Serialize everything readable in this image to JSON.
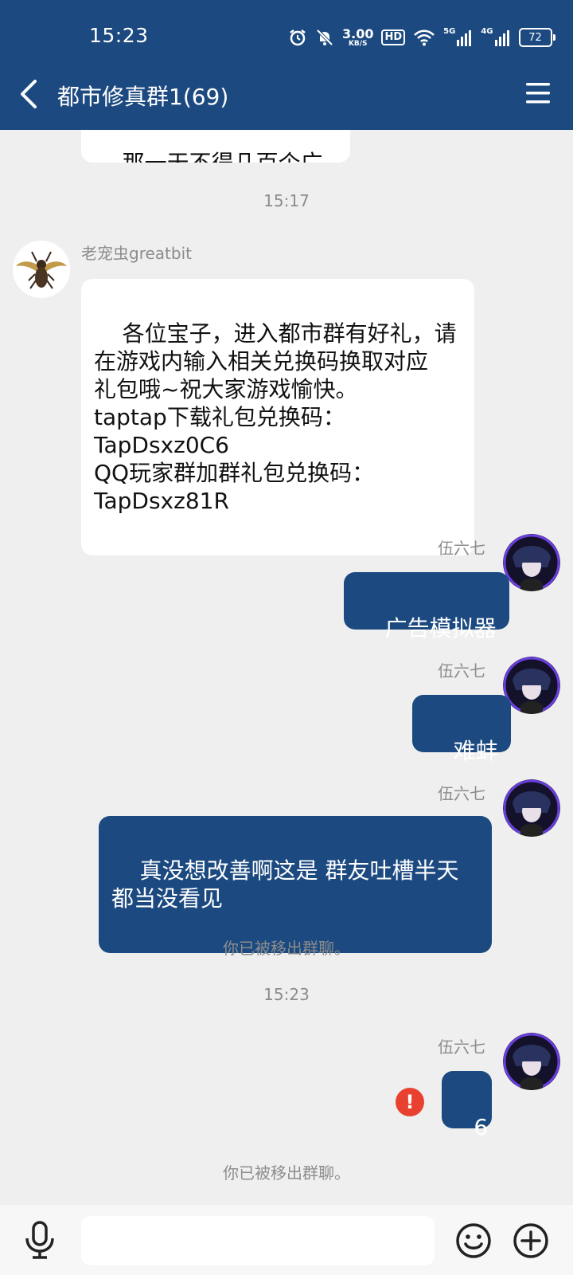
{
  "status_bar": {
    "time": "15:23",
    "net_speed": "3.00",
    "net_speed_unit": "KB/S",
    "hd_label": "HD",
    "net1_label": "5G",
    "net2_label": "4G",
    "battery": "72"
  },
  "header": {
    "title": "都市修真群1(69)"
  },
  "messages": {
    "m0": {
      "text": "那一天不得几百个广告"
    },
    "ts1": "15:17",
    "m1": {
      "sender": "老宠虫greatbit",
      "text": "各位宝子，进入都市群有好礼，请\n在游戏内输入相关兑换码换取对应\n礼包哦~祝大家游戏愉快。\ntaptap下载礼包兑换码：\nTapDsxz0C6\nQQ玩家群加群礼包兑换码：\nTapDsxz81R"
    },
    "m2": {
      "sender": "伍六七",
      "text": "广告模拟器"
    },
    "m3": {
      "sender": "伍六七",
      "text": "难蚌"
    },
    "m4": {
      "sender": "伍六七",
      "text": "真没想改善啊这是 群友吐槽半天\n都当没看见"
    },
    "sys1": "你已被移出群聊。",
    "ts2": "15:23",
    "m5": {
      "sender": "伍六七",
      "text": "6"
    },
    "sys2": "你已被移出群聊。"
  },
  "input": {
    "placeholder": ""
  },
  "colors": {
    "brand": "#1c4a80",
    "background": "#efefef",
    "error": "#e8412f"
  }
}
